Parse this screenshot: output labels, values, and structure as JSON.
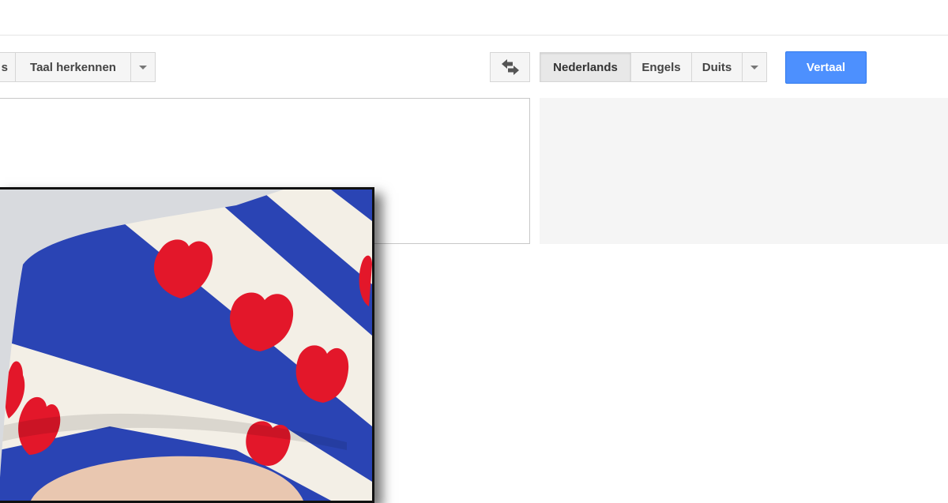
{
  "source_toolbar": {
    "partial_language": "s",
    "detect_language": "Taal herkennen"
  },
  "target_toolbar": {
    "languages": [
      "Nederlands",
      "Engels",
      "Duits"
    ],
    "active_language": "Nederlands",
    "translate_button": "Vertaal"
  },
  "icons": {
    "swap": "swap-arrows-icon",
    "dropdown": "chevron-down-icon"
  },
  "colors": {
    "accent": "#4d90fe",
    "flag_blue": "#2a44b4",
    "flag_white": "#f3efe6",
    "flag_red": "#e3172a"
  },
  "photo": {
    "subject": "Frisian flag patterned knit hat"
  }
}
